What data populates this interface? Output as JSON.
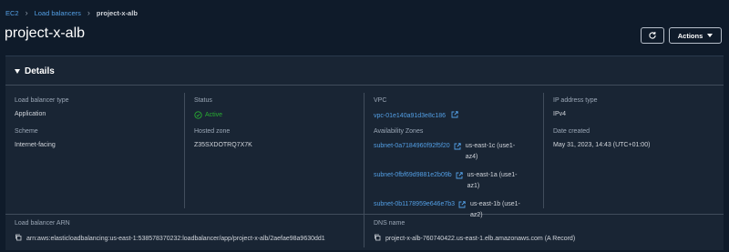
{
  "breadcrumb": {
    "items": [
      "EC2",
      "Load balancers"
    ],
    "current": "project-x-alb"
  },
  "page": {
    "title": "project-x-alb"
  },
  "header": {
    "actions_label": "Actions"
  },
  "details": {
    "title": "Details",
    "load_balancer_type": {
      "label": "Load balancer type",
      "value": "Application"
    },
    "status": {
      "label": "Status",
      "value": "Active",
      "color": "#29ad32"
    },
    "vpc": {
      "label": "VPC",
      "value": "vpc-01e140a91d3e8c186"
    },
    "ip_address_type": {
      "label": "IP address type",
      "value": "IPv4"
    },
    "scheme": {
      "label": "Scheme",
      "value": "Internet-facing"
    },
    "hosted_zone": {
      "label": "Hosted zone",
      "value": "Z35SXDOTRQ7X7K"
    },
    "availability_zones": {
      "label": "Availability Zones",
      "items": [
        {
          "subnet": "subnet-0a7184960f92f5f20",
          "zone": "us-east-1c (use1-az4)"
        },
        {
          "subnet": "subnet-0fbf69d9881e2b09b",
          "zone": "us-east-1a (use1-az1)"
        },
        {
          "subnet": "subnet-0b1178959e646e7b3",
          "zone": "us-east-1b (use1-az2)"
        }
      ]
    },
    "date_created": {
      "label": "Date created",
      "value": "May 31, 2023, 14:43 (UTC+01:00)"
    },
    "arn": {
      "label": "Load balancer ARN",
      "value": "arn:aws:elasticloadbalancing:us-east-1:538578370232:loadbalancer/app/project-x-alb/2aefae98a9630dd1"
    },
    "dns_name": {
      "label": "DNS name",
      "value": "project-x-alb-760740422.us-east-1.elb.amazonaws.com (A Record)"
    }
  },
  "colors": {
    "background": "#0f1b2a",
    "panel": "#192534",
    "link": "#539fe5",
    "success": "#29ad32"
  },
  "icons": [
    "chevron-right-icon",
    "refresh-icon",
    "caret-down-icon",
    "success-check-icon",
    "external-link-icon",
    "copy-icon"
  ]
}
